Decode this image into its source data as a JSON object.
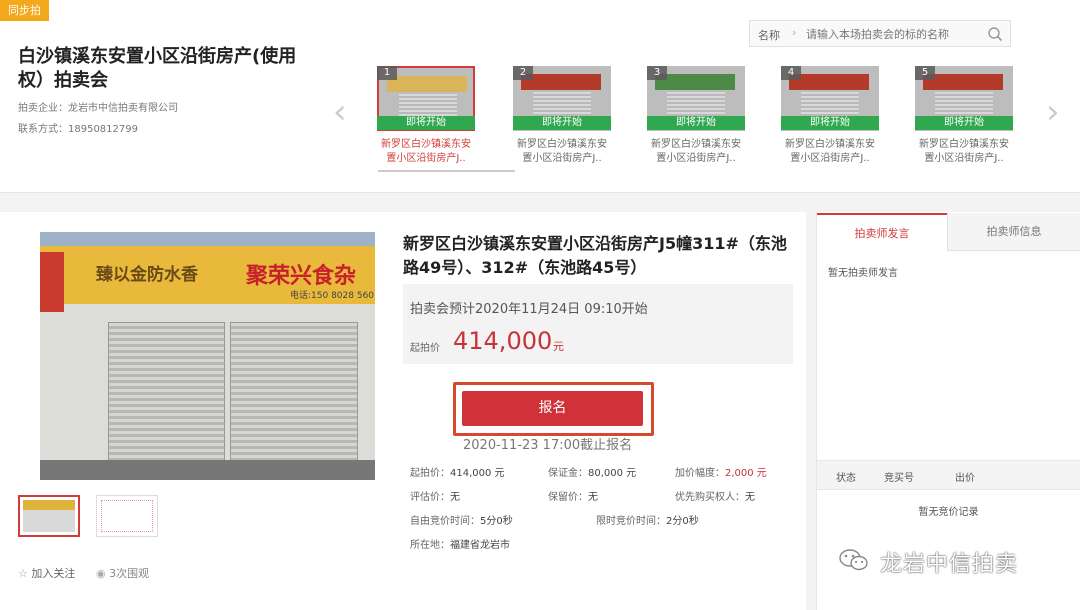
{
  "tag": "同步拍",
  "auction": {
    "title": "白沙镇溪东安置小区沿街房产(使用权）拍卖会",
    "company_label": "拍卖企业：",
    "company": "龙岩市中信拍卖有限公司",
    "contact_label": "联系方式：",
    "contact": "18950812799"
  },
  "search": {
    "label": "名称",
    "placeholder": "请输入本场拍卖会的标的名称"
  },
  "icons": {
    "search": "search-icon",
    "prev": "chevron-left-icon",
    "next": "chevron-right-icon",
    "star": "star-icon",
    "eye": "eye-icon"
  },
  "lots": [
    {
      "num": "1",
      "badge": "即将开始",
      "caption": "新罗区白沙镇溪东安置小区沿街房产J..",
      "active": true
    },
    {
      "num": "2",
      "badge": "即将开始",
      "caption": "新罗区白沙镇溪东安置小区沿街房产J..",
      "active": false
    },
    {
      "num": "3",
      "badge": "即将开始",
      "caption": "新罗区白沙镇溪东安置小区沿街房产J..",
      "active": false
    },
    {
      "num": "4",
      "badge": "即将开始",
      "caption": "新罗区白沙镇溪东安置小区沿街房产J..",
      "active": false
    },
    {
      "num": "5",
      "badge": "即将开始",
      "caption": "新罗区白沙镇溪东安置小区沿街房产J..",
      "active": false
    }
  ],
  "photo": {
    "sign_left": "臻以金防水香",
    "sign_right": "聚荣兴食杂",
    "sign_phone": "电话:150 8028 560"
  },
  "detail": {
    "title": "新罗区白沙镇溪东安置小区沿街房产J5幢311#（东池路49号）、312#（东池路45号）",
    "start_time": "拍卖会预计2020年11月24日  09:10开始",
    "price_label": "起拍价",
    "price": "414,000",
    "price_unit": "元",
    "register": "报名",
    "deadline": "2020-11-23 17:00截止报名"
  },
  "info": {
    "start_price_label": "起拍价：",
    "start_price": "414,000 元",
    "deposit_label": "保证金：",
    "deposit": "80,000 元",
    "increment_label": "加价幅度：",
    "increment": "2,000 元",
    "appraisal_label": "评估价：",
    "appraisal": "无",
    "reserve_label": "保留价：",
    "reserve": "无",
    "priority_label": "优先购买权人：",
    "priority": "无",
    "free_time_label": "自由竞价时间：",
    "free_time": "5分0秒",
    "limit_time_label": "限时竞价时间：",
    "limit_time": "2分0秒",
    "location_label": "所在地：",
    "location": "福建省龙岩市"
  },
  "actions": {
    "follow": "加入关注",
    "views": "3次围观"
  },
  "side": {
    "tab_remarks": "拍卖师发言",
    "tab_info": "拍卖师信息",
    "no_remarks": "暂无拍卖师发言",
    "col_status": "状态",
    "col_bidno": "竞买号",
    "col_price": "出价",
    "no_bids": "暂无竞价记录"
  },
  "watermark": "龙岩中信拍卖",
  "colors": {
    "accent_red": "#cf3339",
    "badge_green": "#2fa84f",
    "tag_orange": "#f4a81c"
  }
}
